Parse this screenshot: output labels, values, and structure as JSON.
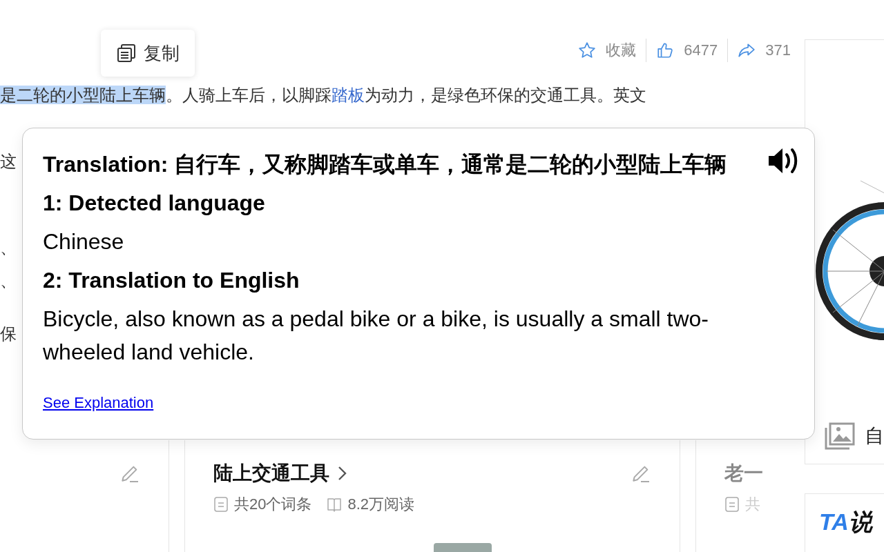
{
  "copy_tooltip": {
    "label": "复制"
  },
  "actions": [
    {
      "kind": "favorite",
      "label": "收藏"
    },
    {
      "kind": "like",
      "label": "6477"
    },
    {
      "kind": "share",
      "label": "371"
    }
  ],
  "article": {
    "lines": [
      [
        {
          "kind": "selected",
          "text": "是二轮的小型陆上车辆"
        },
        {
          "kind": "plain",
          "text": "。人骑上车后，以脚踩"
        },
        {
          "kind": "link",
          "text": "踏板"
        },
        {
          "kind": "plain",
          "text": "为动力，是绿色环保的交通工具。英文"
        }
      ],
      [
        {
          "kind": "plain",
          "text": "这"
        }
      ]
    ],
    "fragments": [
      "、",
      "、",
      "保"
    ]
  },
  "cards": [
    {
      "kind": "edit_only"
    },
    {
      "kind": "topic",
      "title": "陆上交通工具",
      "meta": [
        {
          "kind": "entries",
          "text": "共20个词条"
        },
        {
          "kind": "reads",
          "text": "8.2万阅读"
        }
      ]
    },
    {
      "kind": "faded",
      "title": "老一",
      "meta": [
        {
          "kind": "entries",
          "text": "共"
        }
      ]
    }
  ],
  "sidebar": {
    "image_caption": "自",
    "logo": {
      "part_1": "TA",
      "part_2": "说"
    }
  },
  "popup": {
    "title": "Translation: 自行车，又称脚踏车或单车，通常是二轮的小型陆上车辆",
    "sections": [
      {
        "heading": "1: Detected language",
        "text": "Chinese"
      },
      {
        "heading": "2: Translation to English",
        "text": "Bicycle, also known as a pedal bike or a bike, is usually a small two-wheeled land vehicle."
      }
    ],
    "link": "See Explanation"
  }
}
